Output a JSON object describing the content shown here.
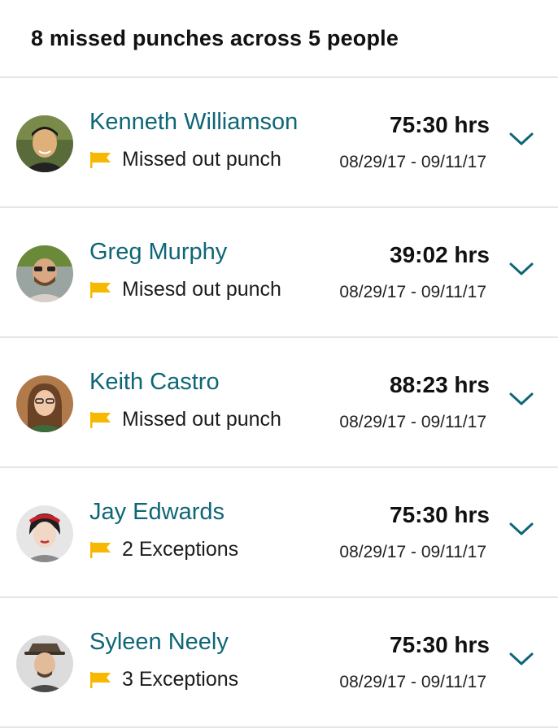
{
  "header": {
    "title": "8 missed punches across 5 people"
  },
  "colors": {
    "name": "#0e6677",
    "flag": "#f6b800",
    "chevron": "#0e6677",
    "divider": "#e6e6e6"
  },
  "rows": [
    {
      "name": "Kenneth Williamson",
      "status": "Missed out punch",
      "hours": "75:30 hrs",
      "dates": "08/29/17 - 09/11/17",
      "icon": "flag-icon",
      "chevron": "chevron-down-icon"
    },
    {
      "name": "Greg Murphy",
      "status": "Misesd out punch",
      "hours": "39:02 hrs",
      "dates": "08/29/17 - 09/11/17",
      "icon": "flag-icon",
      "chevron": "chevron-down-icon"
    },
    {
      "name": "Keith Castro",
      "status": "Missed out punch",
      "hours": "88:23 hrs",
      "dates": "08/29/17 - 09/11/17",
      "icon": "flag-icon",
      "chevron": "chevron-down-icon"
    },
    {
      "name": "Jay Edwards",
      "status": "2 Exceptions",
      "hours": "75:30 hrs",
      "dates": "08/29/17 - 09/11/17",
      "icon": "flag-icon",
      "chevron": "chevron-down-icon"
    },
    {
      "name": "Syleen Neely",
      "status": "3 Exceptions",
      "hours": "75:30 hrs",
      "dates": "08/29/17 - 09/11/17",
      "icon": "flag-icon",
      "chevron": "chevron-down-icon"
    }
  ]
}
